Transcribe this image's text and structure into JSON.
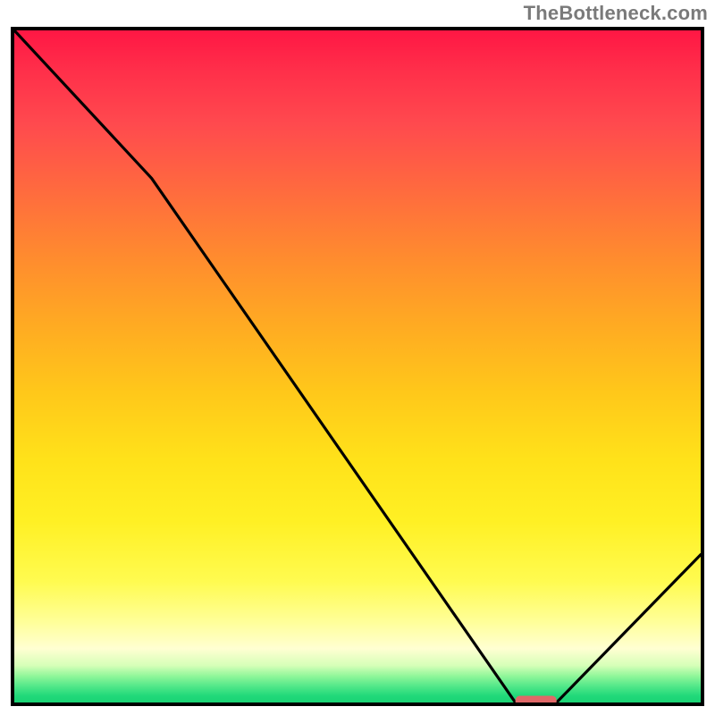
{
  "attribution": "TheBottleneck.com",
  "chart_data": {
    "type": "line",
    "title": "",
    "xlabel": "",
    "ylabel": "",
    "xlim": [
      0,
      100
    ],
    "ylim": [
      0,
      100
    ],
    "x": [
      0,
      20,
      73,
      79,
      100
    ],
    "y": [
      100,
      78,
      0,
      0,
      22
    ],
    "minimum_marker": {
      "x_start": 73,
      "x_end": 79,
      "y": 0
    },
    "annotations": [],
    "legend": null,
    "grid": false
  },
  "colors": {
    "border": "#000000",
    "curve": "#000000",
    "marker": "#e06868",
    "gradient_top": "#ff1744",
    "gradient_bottom": "#1ad374",
    "attribution": "#7a7a7a"
  }
}
